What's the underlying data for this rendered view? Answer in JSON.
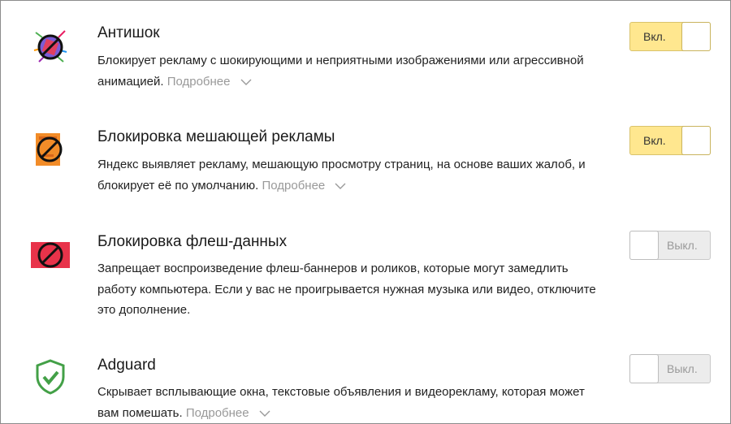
{
  "extensions": [
    {
      "title": "Антишок",
      "description": "Блокирует рекламу с шокирующими и неприятными изображениями или агрессивной анимацией.",
      "more": "Подробнее",
      "toggle": "Вкл.",
      "enabled": true,
      "icon": "antishock-icon"
    },
    {
      "title": "Блокировка мешающей рекламы",
      "description": "Яндекс выявляет рекламу, мешающую просмотру страниц, на основе ваших жалоб, и блокирует её по умолчанию.",
      "more": "Подробнее",
      "toggle": "Вкл.",
      "enabled": true,
      "icon": "ad-block-icon"
    },
    {
      "title": "Блокировка флеш-данных",
      "description": "Запрещает воспроизведение флеш-баннеров и роликов, которые могут замедлить работу компьютера. Если у вас не проигрывается нужная музыка или видео, отключите это дополнение.",
      "toggle": "Выкл.",
      "enabled": false,
      "icon": "flash-block-icon"
    },
    {
      "title": "Adguard",
      "description": "Скрывает всплывающие окна, текстовые объявления и видеорекламу, которая может вам помешать.",
      "more": "Подробнее",
      "toggle": "Выкл.",
      "enabled": false,
      "icon": "adguard-shield-icon"
    }
  ],
  "colors": {
    "toggle_on": "#ffe78f",
    "toggle_off": "#ececec",
    "more_link": "#999999"
  }
}
